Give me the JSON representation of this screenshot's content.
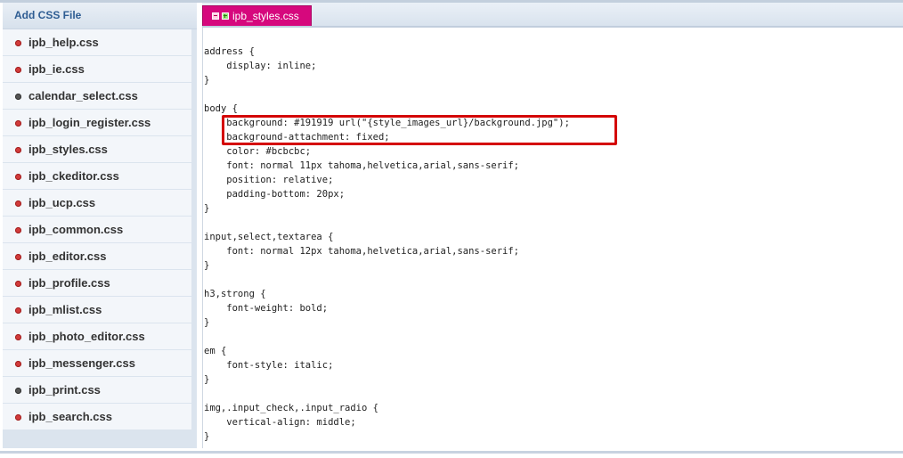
{
  "sidebar": {
    "header": "Add CSS File",
    "files": [
      {
        "name": "ipb_help.css",
        "status": "red"
      },
      {
        "name": "ipb_ie.css",
        "status": "red"
      },
      {
        "name": "calendar_select.css",
        "status": "gray"
      },
      {
        "name": "ipb_login_register.css",
        "status": "red"
      },
      {
        "name": "ipb_styles.css",
        "status": "red"
      },
      {
        "name": "ipb_ckeditor.css",
        "status": "red"
      },
      {
        "name": "ipb_ucp.css",
        "status": "red"
      },
      {
        "name": "ipb_common.css",
        "status": "red"
      },
      {
        "name": "ipb_editor.css",
        "status": "red"
      },
      {
        "name": "ipb_profile.css",
        "status": "red"
      },
      {
        "name": "ipb_mlist.css",
        "status": "red"
      },
      {
        "name": "ipb_photo_editor.css",
        "status": "red"
      },
      {
        "name": "ipb_messenger.css",
        "status": "red"
      },
      {
        "name": "ipb_print.css",
        "status": "gray"
      },
      {
        "name": "ipb_search.css",
        "status": "red"
      }
    ]
  },
  "tab": {
    "label": "ipb_styles.css",
    "collapse_icon": "minus-box-icon",
    "expand_icon": "plus-box-icon"
  },
  "editor": {
    "lines": [
      "address {",
      "    display: inline;",
      "}",
      "",
      "body {",
      "    background: #191919 url(\"{style_images_url}/background.jpg\");",
      "    background-attachment: fixed;",
      "    color: #bcbcbc;",
      "    font: normal 11px tahoma,helvetica,arial,sans-serif;",
      "    position: relative;",
      "    padding-bottom: 20px;",
      "}",
      "",
      "input,select,textarea {",
      "    font: normal 12px tahoma,helvetica,arial,sans-serif;",
      "}",
      "",
      "h3,strong {",
      "    font-weight: bold;",
      "}",
      "",
      "em {",
      "    font-style: italic;",
      "}",
      "",
      "img,.input_check,.input_radio {",
      "    vertical-align: middle;",
      "}"
    ]
  },
  "colors": {
    "tab_active": "#d6087d",
    "sidebar_header_text": "#2f5d93",
    "status_red": "#d23b3b",
    "status_gray": "#555555",
    "highlight_box": "#d40000"
  }
}
